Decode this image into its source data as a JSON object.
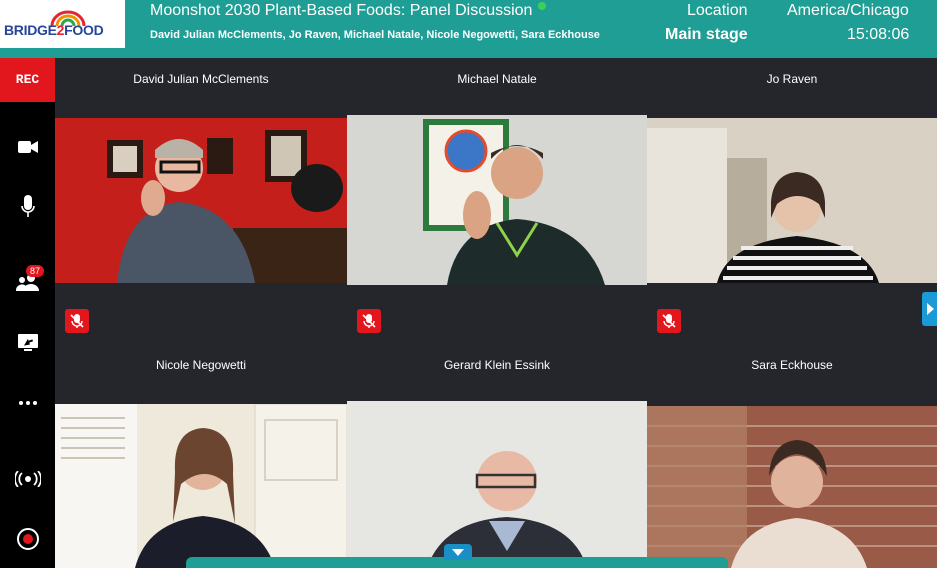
{
  "header": {
    "logo": {
      "part1": "BRIDGE",
      "part2": "2",
      "part3": "FOOD"
    },
    "title": "Moonshot 2030 Plant-Based Foods: Panel Discussion",
    "panelists": "David Julian McClements, Jo Raven, Michael Natale, Nicole Negowetti, Sara Eckhouse",
    "location_label": "Location",
    "location_value": "Main stage",
    "timezone": "America/Chicago",
    "clock": "15:08:06"
  },
  "sidebar": {
    "rec_label": "REC",
    "participants_count": "87",
    "icons": [
      "camera-icon",
      "microphone-icon",
      "participants-icon",
      "screen-share-icon",
      "more-icon",
      "broadcast-icon",
      "record-icon"
    ]
  },
  "tiles": [
    {
      "name": "David Julian McClements",
      "muted": true
    },
    {
      "name": "Michael Natale",
      "muted": true
    },
    {
      "name": "Jo Raven",
      "muted": true
    },
    {
      "name": "Nicole Negowetti",
      "muted": false
    },
    {
      "name": "Gerard Klein Essink",
      "muted": false
    },
    {
      "name": "Sara Eckhouse",
      "muted": false
    }
  ],
  "colors": {
    "accent": "#1f9e95",
    "rec": "#e2161d",
    "tile_bg": "#24262b",
    "sidebar": "#000000"
  }
}
